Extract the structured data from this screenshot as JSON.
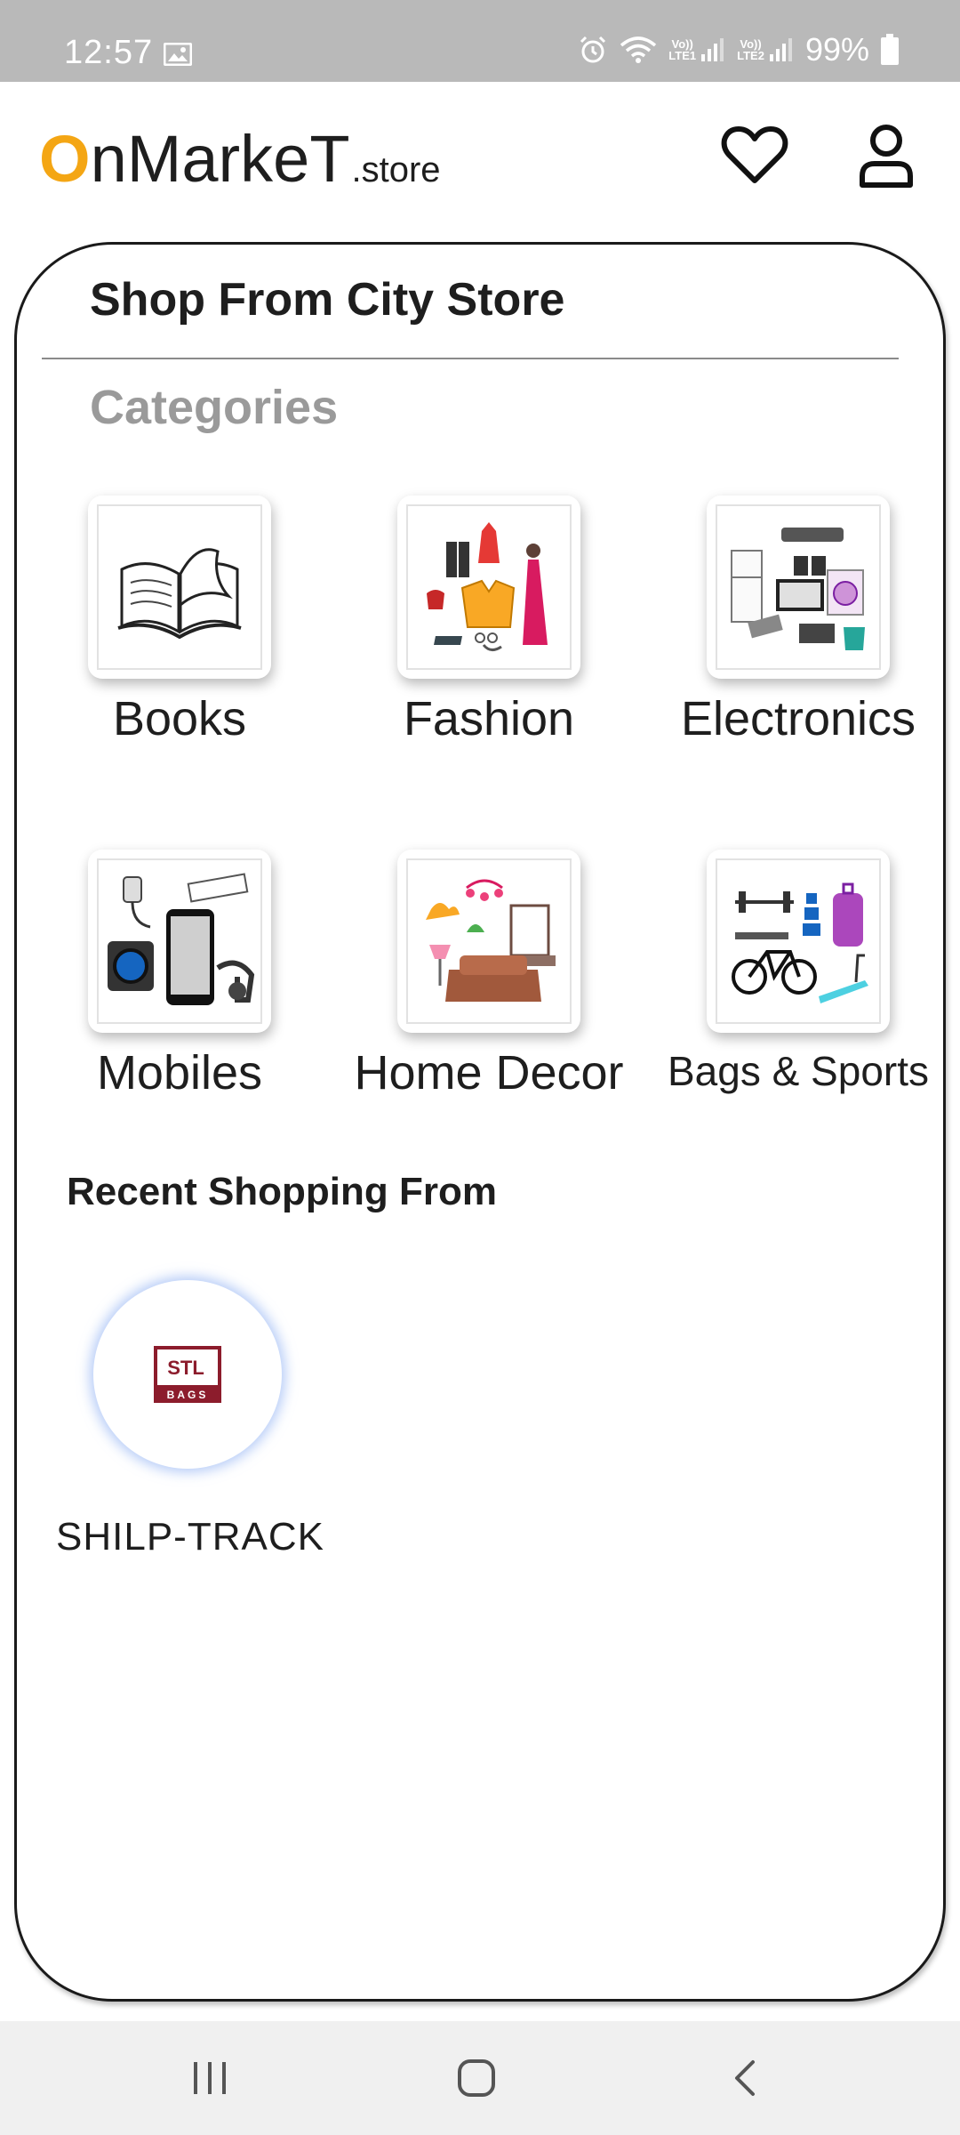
{
  "status_bar": {
    "time": "12:57",
    "battery": "99%",
    "sim1_label": "Vo))\nLTE1",
    "sim2_label": "Vo))\nLTE2",
    "icons": [
      "gallery-icon",
      "alarm-icon",
      "wifi-icon",
      "signal-icon",
      "battery-icon"
    ]
  },
  "header": {
    "logo_first": "O",
    "logo_main": "nMarkeT",
    "logo_suffix": ".store",
    "brand_color": "#f4a614",
    "icons": [
      "heart-icon",
      "user-icon"
    ]
  },
  "card": {
    "title": "Shop From City Store",
    "categories_heading": "Categories",
    "categories": [
      {
        "label": "Books",
        "icon": "book-icon"
      },
      {
        "label": "Fashion",
        "icon": "fashion-icon"
      },
      {
        "label": "Electronics",
        "icon": "electronics-icon"
      },
      {
        "label": "Mobiles",
        "icon": "mobiles-icon"
      },
      {
        "label": "Home Decor",
        "icon": "home-decor-icon"
      },
      {
        "label": "Bags & Sports",
        "icon": "bags-sports-icon"
      }
    ],
    "recent_heading": "Recent Shopping From",
    "recent_stores": [
      {
        "name": "SHILP-TRACK",
        "logo_text": "STL",
        "logo_sub": "BAGS",
        "logo_color": "#8c1c2c"
      }
    ]
  },
  "nav_bar": {
    "icons": [
      "recent-apps-icon",
      "home-icon",
      "back-icon"
    ]
  }
}
